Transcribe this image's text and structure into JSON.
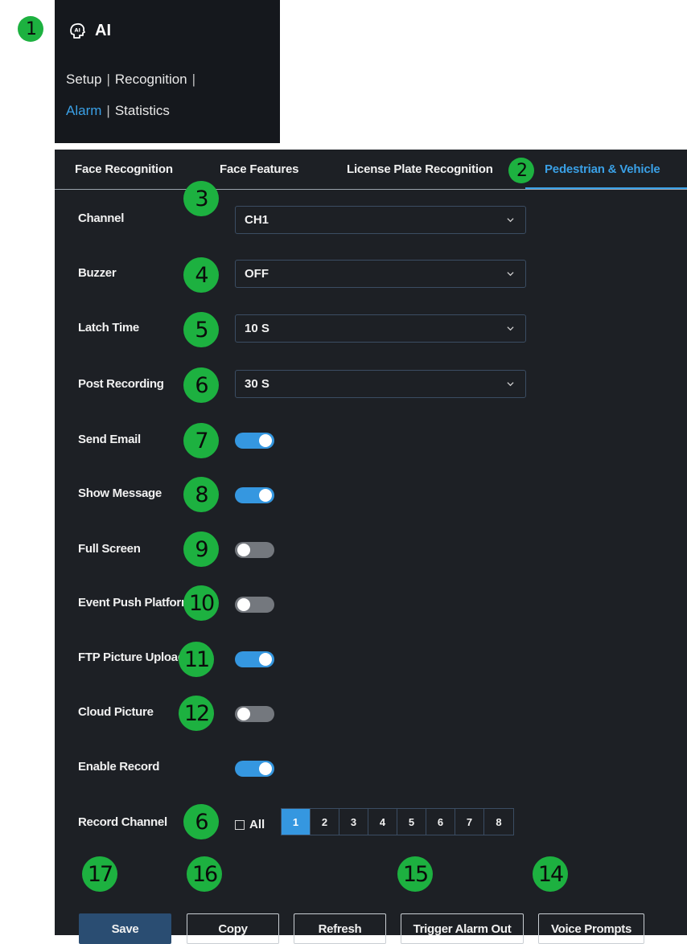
{
  "menu": {
    "title": "AI",
    "items_row1": [
      "Setup",
      "Recognition"
    ],
    "items_row2": [
      "Alarm",
      "Statistics"
    ],
    "separator": "|"
  },
  "tabs": [
    {
      "label": "Face Recognition"
    },
    {
      "label": "Face Features"
    },
    {
      "label": "License Plate Recognition"
    },
    {
      "label": "Pedestrian & Vehicle"
    }
  ],
  "fields": {
    "channel": {
      "label": "Channel",
      "value": "CH1"
    },
    "buzzer": {
      "label": "Buzzer",
      "value": "OFF"
    },
    "latch_time": {
      "label": "Latch Time",
      "value": "10 S"
    },
    "post_recording": {
      "label": "Post Recording",
      "value": "30 S"
    }
  },
  "toggles": {
    "send_email": {
      "label": "Send Email",
      "on": true
    },
    "show_message": {
      "label": "Show Message",
      "on": true
    },
    "full_screen": {
      "label": "Full Screen",
      "on": false
    },
    "event_push": {
      "label": "Event Push Platform",
      "on": false
    },
    "ftp_picture": {
      "label": "FTP Picture Upload",
      "on": true
    },
    "cloud_picture": {
      "label": "Cloud Picture",
      "on": false
    },
    "enable_record": {
      "label": "Enable Record",
      "on": true
    }
  },
  "record_channel": {
    "label": "Record Channel",
    "all_label": "All",
    "channels": [
      "1",
      "2",
      "3",
      "4",
      "5",
      "6",
      "7",
      "8"
    ],
    "selected": "1"
  },
  "buttons": {
    "save": "Save",
    "copy": "Copy",
    "refresh": "Refresh",
    "trigger": "Trigger Alarm Out",
    "voice": "Voice Prompts"
  },
  "badges": {
    "b1": "1",
    "b2": "2",
    "b3": "3",
    "b4": "4",
    "b5": "5",
    "b6a": "6",
    "b7": "7",
    "b8": "8",
    "b9": "9",
    "b10": "10",
    "b11": "11",
    "b12": "12",
    "b6b": "6",
    "b17": "17",
    "b16": "16",
    "b15": "15",
    "b14": "14"
  },
  "colors": {
    "accent": "#3597e0",
    "badge": "#1db140",
    "panel_bg": "#1d2025",
    "toggle_off": "#74787e"
  }
}
